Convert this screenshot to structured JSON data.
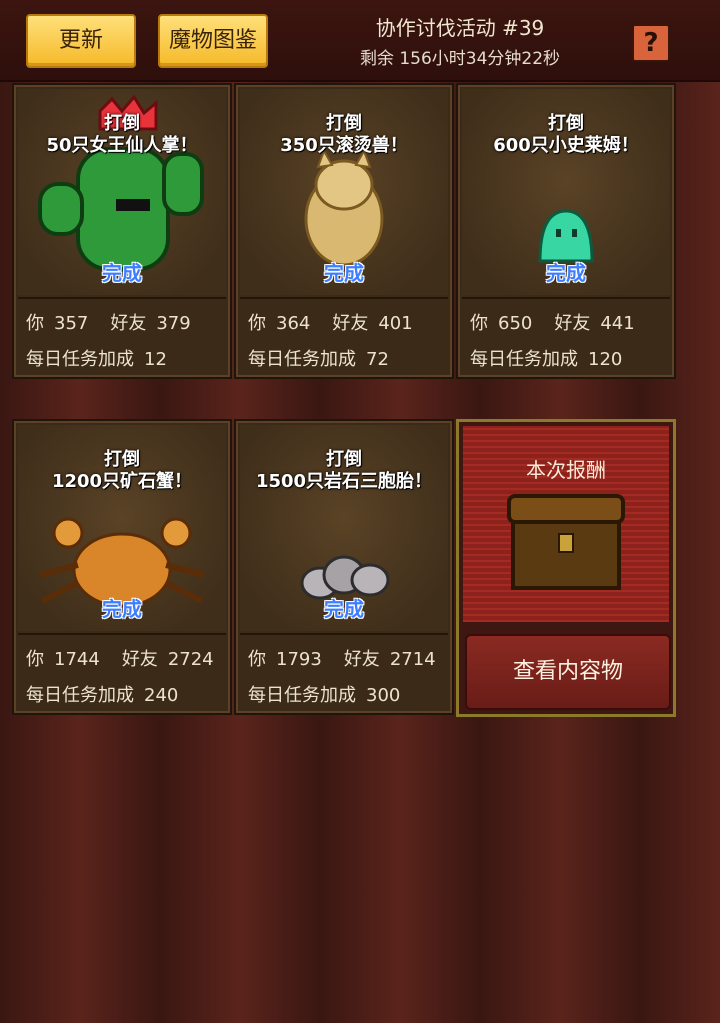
{
  "header": {
    "update_label": "更新",
    "bestiary_label": "魔物图鉴",
    "title": "协作讨伐活动 #39",
    "timer": "剩余 156小时34分钟22秒",
    "help_label": "?"
  },
  "quests": [
    {
      "line1": "打倒",
      "line2": "50只女王仙人掌！",
      "status": "完成",
      "you_label": "你",
      "you": "357",
      "friend_label": "好友",
      "friend": "379",
      "bonus_label": "每日任务加成",
      "bonus": "12",
      "monster": "queen-cactus-icon"
    },
    {
      "line1": "打倒",
      "line2": "350只滚烫兽！",
      "status": "完成",
      "you_label": "你",
      "you": "364",
      "friend_label": "好友",
      "friend": "401",
      "bonus_label": "每日任务加成",
      "bonus": "72",
      "monster": "scalding-beast-icon"
    },
    {
      "line1": "打倒",
      "line2": "600只小史莱姆！",
      "status": "完成",
      "you_label": "你",
      "you": "650",
      "friend_label": "好友",
      "friend": "441",
      "bonus_label": "每日任务加成",
      "bonus": "120",
      "monster": "small-slime-icon"
    },
    {
      "line1": "打倒",
      "line2": "1200只矿石蟹！",
      "status": "完成",
      "you_label": "你",
      "you": "1744",
      "friend_label": "好友",
      "friend": "2724",
      "bonus_label": "每日任务加成",
      "bonus": "240",
      "monster": "ore-crab-icon"
    },
    {
      "line1": "打倒",
      "line2": "1500只岩石三胞胎！",
      "status": "完成",
      "you_label": "你",
      "you": "1793",
      "friend_label": "好友",
      "friend": "2714",
      "bonus_label": "每日任务加成",
      "bonus": "300",
      "monster": "rock-triplets-icon"
    }
  ],
  "reward": {
    "title": "本次报酬",
    "view_label": "查看内容物",
    "icon": "treasure-chest-icon"
  }
}
